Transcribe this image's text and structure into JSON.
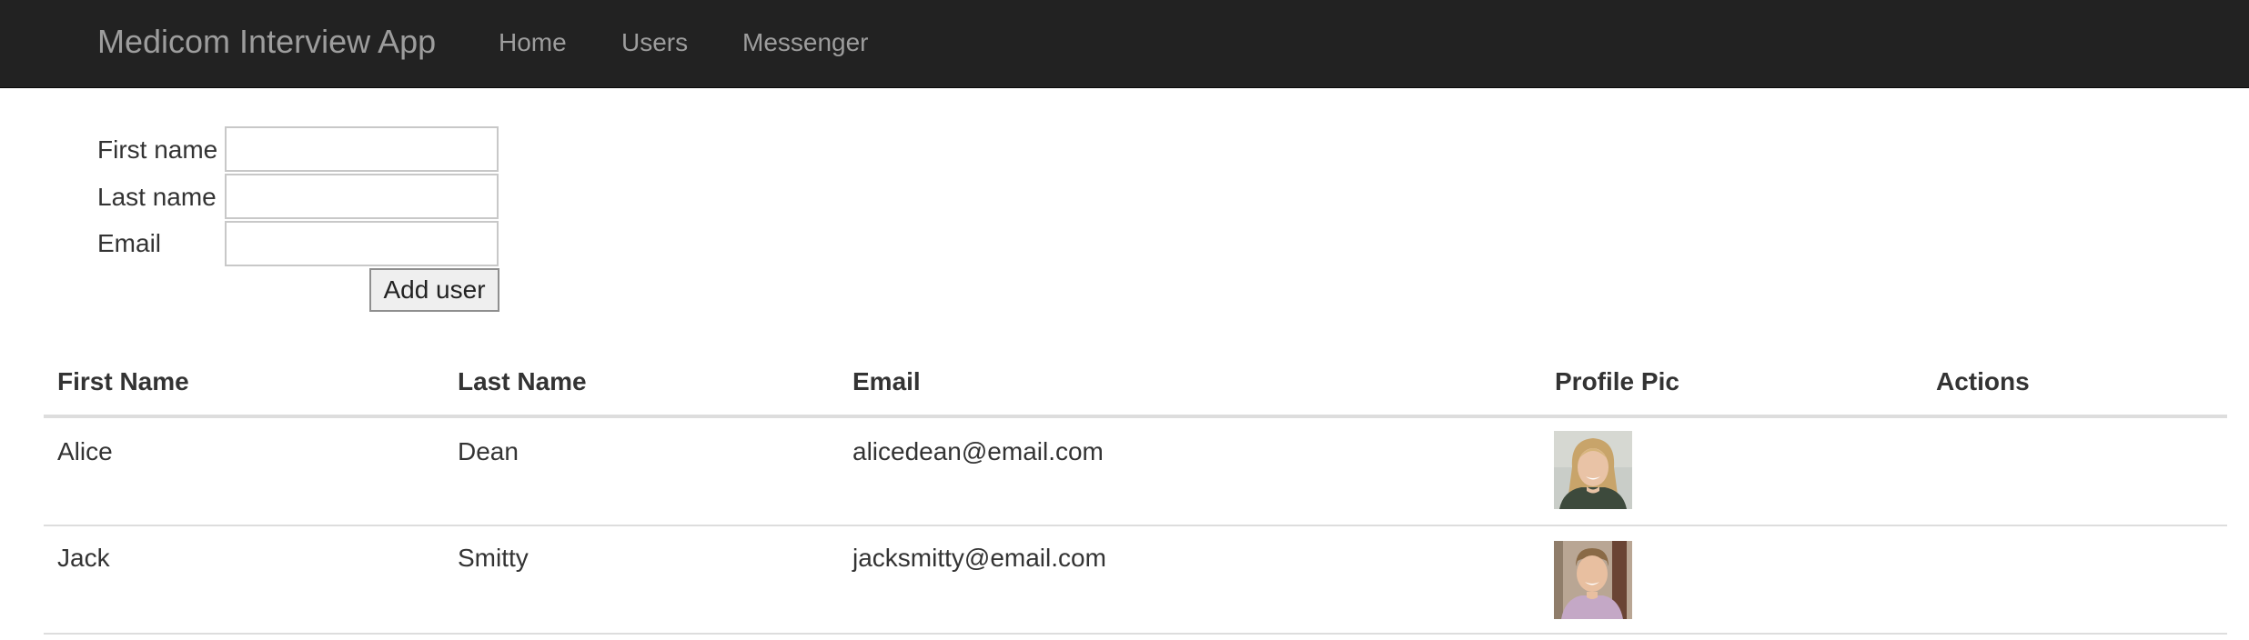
{
  "navbar": {
    "brand": "Medicom Interview App",
    "links": [
      "Home",
      "Users",
      "Messenger"
    ]
  },
  "form": {
    "first_name_label": "First name",
    "last_name_label": "Last name",
    "email_label": "Email",
    "first_name_value": "",
    "last_name_value": "",
    "email_value": "",
    "add_button_label": "Add user"
  },
  "table": {
    "headers": [
      "First Name",
      "Last Name",
      "Email",
      "Profile Pic",
      "Actions"
    ],
    "rows": [
      {
        "first_name": "Alice",
        "last_name": "Dean",
        "email": "alicedean@email.com",
        "profile_pic": "photo of smiling woman with blonde hair"
      },
      {
        "first_name": "Jack",
        "last_name": "Smitty",
        "email": "jacksmitty@email.com",
        "profile_pic": "photo of smiling young man near tree"
      }
    ]
  },
  "colors": {
    "navbar_bg": "#222222",
    "navbar_text": "#9d9d9d",
    "body_text": "#333333",
    "rule": "#dddddd"
  }
}
